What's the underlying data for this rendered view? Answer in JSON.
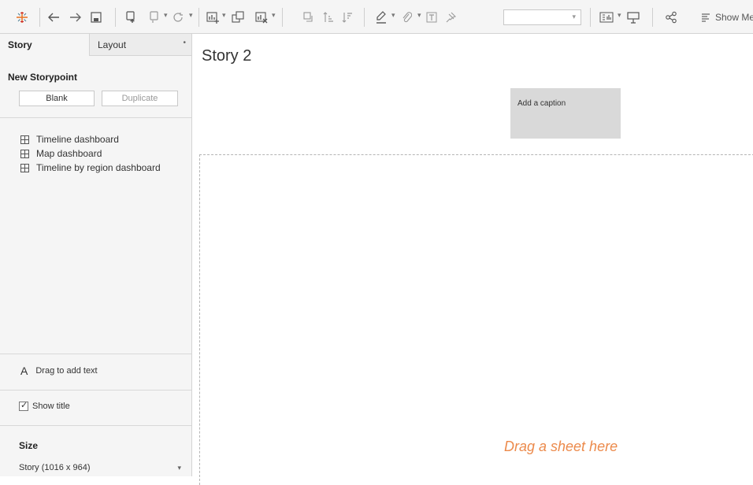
{
  "toolbar": {
    "show_me_label": "Show Me"
  },
  "sidebar": {
    "tabs": [
      {
        "label": "Story"
      },
      {
        "label": "Layout"
      }
    ],
    "new_storypoint": {
      "heading": "New Storypoint",
      "blank_label": "Blank",
      "duplicate_label": "Duplicate"
    },
    "dashboards": [
      {
        "label": "Timeline dashboard"
      },
      {
        "label": "Map dashboard"
      },
      {
        "label": "Timeline by region dashboard"
      }
    ],
    "drag_text_label": "Drag to add text",
    "show_title_label": "Show title",
    "show_title_checked": true,
    "size_heading": "Size",
    "size_value": "Story (1016 x 964)"
  },
  "canvas": {
    "title": "Story 2",
    "caption_placeholder": "Add a caption",
    "drop_hint": "Drag a sheet here",
    "drop_hint_color": "#ec8a4b"
  }
}
